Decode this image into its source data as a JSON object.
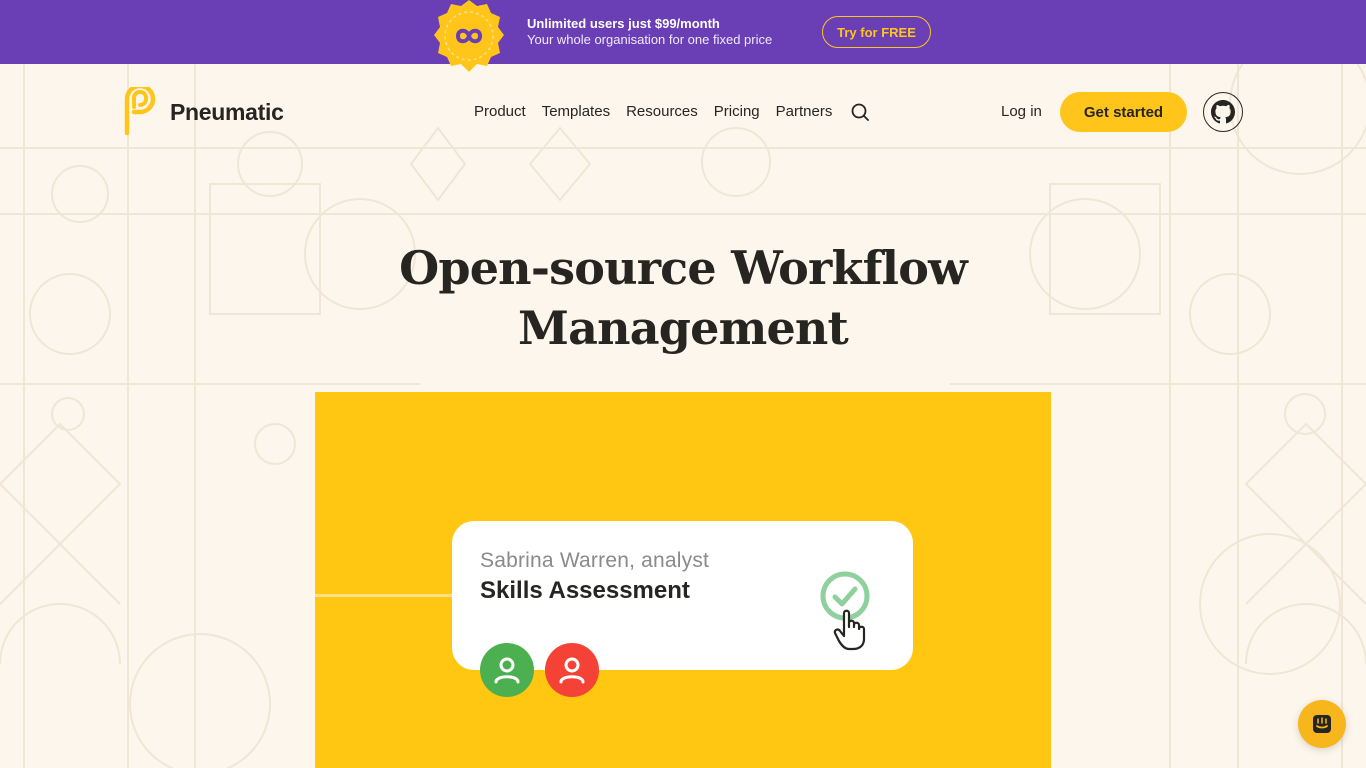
{
  "promo": {
    "title": "Unlimited users just $99/month",
    "subtitle": "Your whole organisation for one fixed price",
    "cta_label": "Try for FREE",
    "badge_icon": "infinity-icon"
  },
  "header": {
    "logo_text": "Pneumatic",
    "nav": [
      {
        "label": "Product"
      },
      {
        "label": "Templates"
      },
      {
        "label": "Resources"
      },
      {
        "label": "Pricing"
      },
      {
        "label": "Partners"
      }
    ],
    "search_icon": "search-icon",
    "login_label": "Log in",
    "get_started_label": "Get started",
    "github_icon": "github-icon"
  },
  "hero": {
    "title_line1": "Open-source Workflow",
    "title_line2": "Management"
  },
  "task_card": {
    "assignee": "Sabrina Warren, analyst",
    "title": "Skills Assessment"
  },
  "colors": {
    "promo_bg": "#6a3eb5",
    "accent_yellow": "#ffc51a",
    "page_bg": "#fdf6ec",
    "check_green": "#8fd19e",
    "avatar_green": "#4caf50",
    "avatar_red": "#f44336",
    "chat_orange": "#f7b61b"
  },
  "chat": {
    "icon": "chat-icon"
  }
}
